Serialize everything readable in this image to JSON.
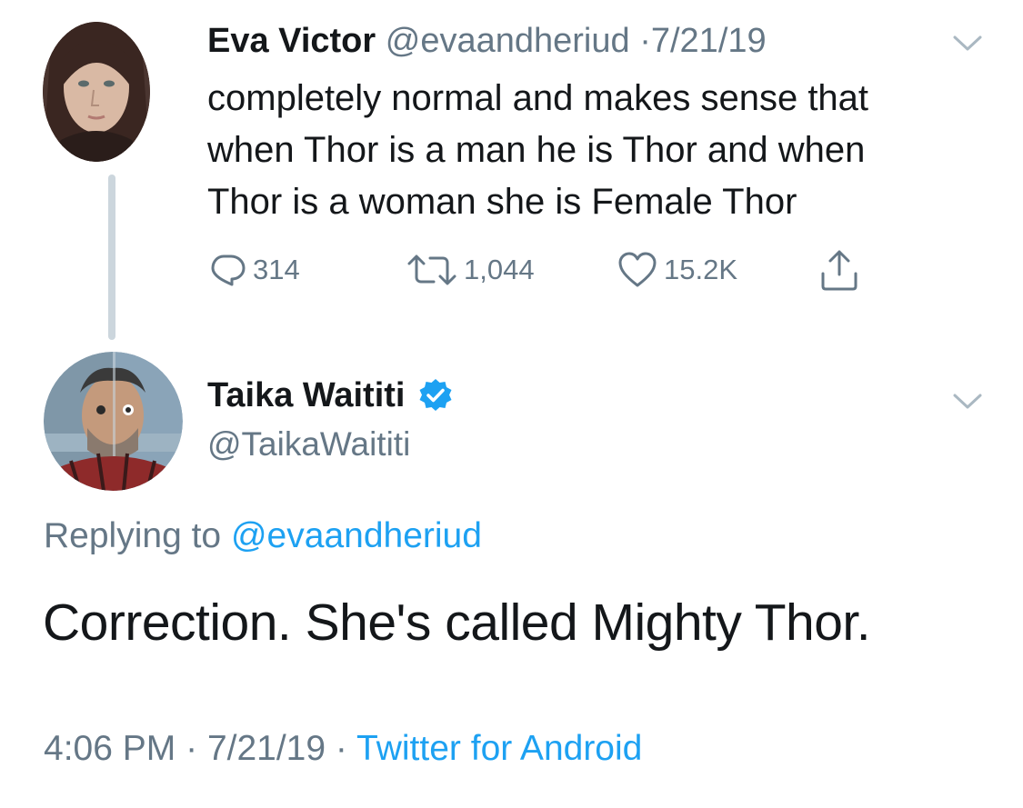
{
  "parent_tweet": {
    "display_name": "Eva Victor",
    "handle": "@evaandheriud",
    "separator": "·",
    "date": "7/21/19",
    "text_lines": [
      "completely normal and makes sense that",
      "when Thor is a man he is Thor and when",
      "Thor is a woman she is Female Thor"
    ],
    "actions": {
      "reply_icon": "reply-icon",
      "reply_count": "314",
      "retweet_icon": "retweet-icon",
      "retweet_count": "1,044",
      "like_icon": "heart-icon",
      "like_count": "15.2K",
      "share_icon": "share-icon"
    }
  },
  "reply_tweet": {
    "display_name": "Taika Waititi",
    "verified_icon": "verified-badge-icon",
    "handle": "@TaikaWaititi",
    "replying_label": "Replying to",
    "replying_to": "@evaandheriud",
    "text": "Correction. She's called Mighty Thor.",
    "time": "4:06 PM",
    "separator": "·",
    "date": "7/21/19",
    "source": "Twitter for Android"
  },
  "colors": {
    "text_primary": "#14171a",
    "text_muted": "#657786",
    "link": "#1da1f2",
    "thread_line": "#ccd6dd"
  }
}
